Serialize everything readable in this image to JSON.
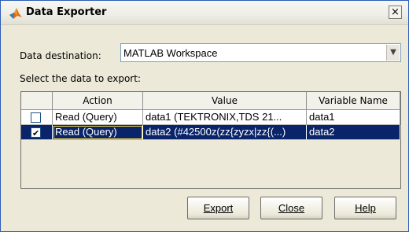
{
  "window": {
    "title": "Data Exporter",
    "close_glyph": "×"
  },
  "destination": {
    "label": "Data destination:",
    "value": "MATLAB Workspace"
  },
  "select_label": "Select the data to export:",
  "table": {
    "columns": [
      "",
      "Action",
      "Value",
      "Variable Name"
    ],
    "rows": [
      {
        "checked": false,
        "action": "Read (Query)",
        "value": "data1 (TEKTRONIX,TDS 21...",
        "variable": "data1"
      },
      {
        "checked": true,
        "action": "Read (Query)",
        "value": "data2 (#42500z(zz{zyzx|zz{(...)",
        "variable": "data2"
      }
    ]
  },
  "buttons": {
    "export": "Export",
    "close": "Close",
    "help": "Help"
  },
  "colors": {
    "selection": "#0a246a",
    "title_accent": "#2c5db8"
  }
}
